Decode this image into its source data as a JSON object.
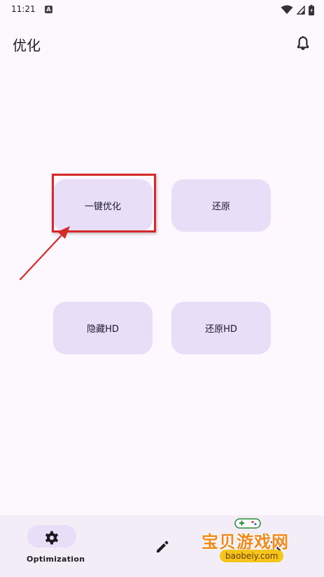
{
  "status_bar": {
    "time": "11:21",
    "notification_icon_letter": "A"
  },
  "app_bar": {
    "title": "优化"
  },
  "actions": {
    "optimize_label": "一键优化",
    "restore_label": "还原",
    "hide_hd_label": "隐藏HD",
    "restore_hd_label": "还原HD"
  },
  "bottom_nav": {
    "items": [
      {
        "label": "Optimization",
        "icon": "gear-icon",
        "selected": true
      },
      {
        "label": "",
        "icon": "pencil-icon",
        "selected": false
      },
      {
        "label": "",
        "icon": "close-icon",
        "selected": false
      }
    ]
  },
  "watermark": {
    "title": "宝贝游戏网",
    "url": "baobeiy.com"
  },
  "colors": {
    "background": "#fdf7fe",
    "button_fill": "#e8def8",
    "nav_background": "#f3edf7",
    "highlight_red": "#d42a2a"
  }
}
